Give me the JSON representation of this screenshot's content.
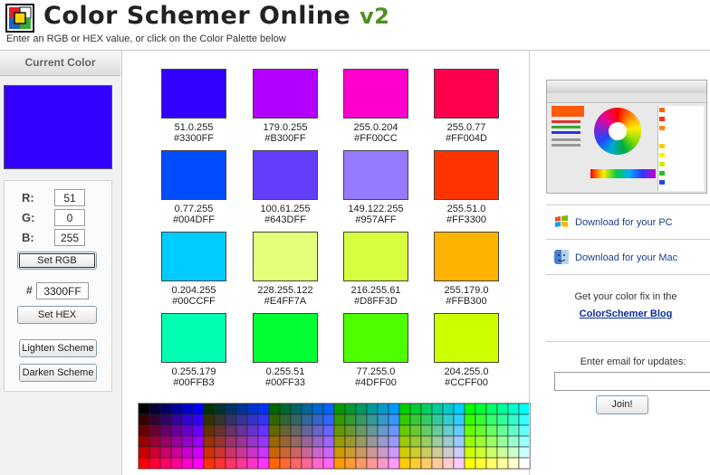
{
  "header": {
    "title": "Color Schemer Online",
    "version": "v2",
    "subtitle": "Enter an RGB or HEX value, or click on the Color Palette below"
  },
  "left": {
    "current_label": "Current Color",
    "current_color": "#3300FF",
    "r_label": "R:",
    "g_label": "G:",
    "b_label": "B:",
    "r_value": "51",
    "g_value": "0",
    "b_value": "255",
    "set_rgb": "Set RGB",
    "hash": "#",
    "hex_value": "3300FF",
    "set_hex": "Set HEX",
    "lighten": "Lighten Scheme",
    "darken": "Darken Scheme"
  },
  "swatches": [
    {
      "rgb": "51.0.255",
      "hex": "#3300FF"
    },
    {
      "rgb": "179.0.255",
      "hex": "#B300FF"
    },
    {
      "rgb": "255.0.204",
      "hex": "#FF00CC"
    },
    {
      "rgb": "255.0.77",
      "hex": "#FF004D"
    },
    {
      "rgb": "0.77.255",
      "hex": "#004DFF"
    },
    {
      "rgb": "100.61.255",
      "hex": "#643DFF"
    },
    {
      "rgb": "149.122.255",
      "hex": "#957AFF"
    },
    {
      "rgb": "255.51.0",
      "hex": "#FF3300"
    },
    {
      "rgb": "0.204.255",
      "hex": "#00CCFF"
    },
    {
      "rgb": "228.255.122",
      "hex": "#E4FF7A"
    },
    {
      "rgb": "216.255.61",
      "hex": "#D8FF3D"
    },
    {
      "rgb": "255.179.0",
      "hex": "#FFB300"
    },
    {
      "rgb": "0.255.179",
      "hex": "#00FFB3"
    },
    {
      "rgb": "0.255.51",
      "hex": "#00FF33"
    },
    {
      "rgb": "77.255.0",
      "hex": "#4DFF00"
    },
    {
      "rgb": "204.255.0",
      "hex": "#CCFF00"
    }
  ],
  "right": {
    "download_pc": "Download for your PC",
    "download_mac": "Download for your Mac",
    "color_fix": "Get your color fix in the",
    "blog": "ColorSchemer Blog",
    "email_label": "Enter email for updates:",
    "join": "Join!"
  }
}
